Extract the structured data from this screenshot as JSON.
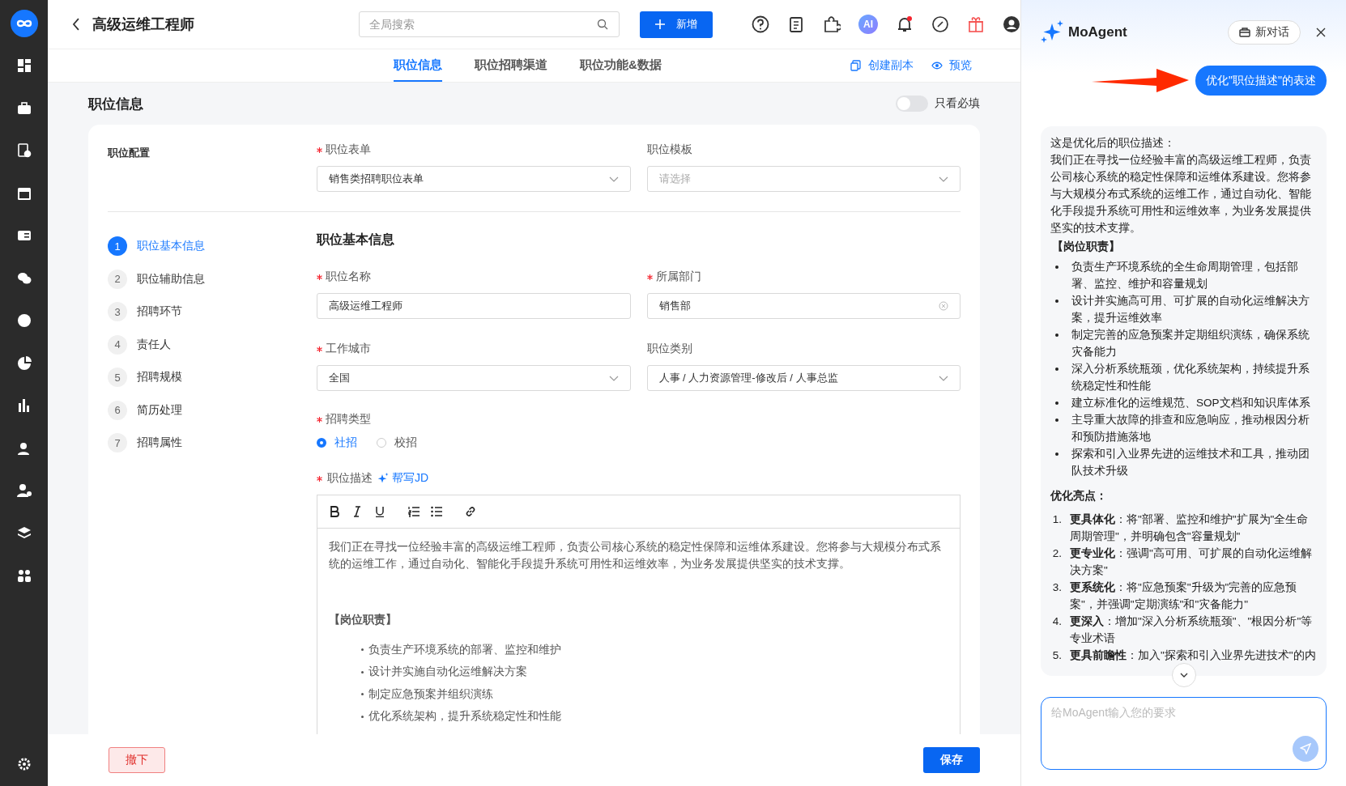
{
  "header": {
    "title": "高级运维工程师",
    "search": {
      "placeholder": "全局搜索"
    },
    "new_button": "新增",
    "ai_badge": "AI"
  },
  "tabs": [
    {
      "label": "职位信息",
      "selected": true
    },
    {
      "label": "职位招聘渠道",
      "selected": false
    },
    {
      "label": "职位功能&数据",
      "selected": false
    }
  ],
  "tab_actions": [
    "创建副本",
    "预览"
  ],
  "section": {
    "title": "职位信息",
    "toggle": {
      "label": "只看必填",
      "on": false
    }
  },
  "config": {
    "label": "职位配置",
    "fields": [
      {
        "label": "职位表单",
        "required": true,
        "value": "销售类招聘职位表单",
        "kind": "select"
      },
      {
        "label": "职位模板",
        "required": false,
        "placeholder": "请选择",
        "kind": "select"
      }
    ]
  },
  "steps": [
    {
      "number": "1",
      "label": "职位基本信息",
      "selected": true
    },
    {
      "number": "2",
      "label": "职位辅助信息",
      "selected": false
    },
    {
      "number": "3",
      "label": "招聘环节",
      "selected": false
    },
    {
      "number": "4",
      "label": "责任人",
      "selected": false
    },
    {
      "number": "5",
      "label": "招聘规模",
      "selected": false
    },
    {
      "number": "6",
      "label": "简历处理",
      "selected": false
    },
    {
      "number": "7",
      "label": "招聘属性",
      "selected": false
    }
  ],
  "basic_info": {
    "title": "职位基本信息",
    "fields": [
      {
        "label": "职位名称",
        "required": true,
        "value": "高级运维工程师",
        "kind": "input"
      },
      {
        "label": "所属部门",
        "required": true,
        "value": "销售部",
        "kind": "clearable"
      },
      {
        "label": "工作城市",
        "required": true,
        "value": "全国",
        "kind": "select"
      },
      {
        "label": "职位类别",
        "required": false,
        "value": "人事 / 人力资源管理-修改后 / 人事总监",
        "kind": "select"
      }
    ],
    "recruit_type": {
      "label": "招聘类型",
      "required": true,
      "options": [
        {
          "label": "社招",
          "selected": true
        },
        {
          "label": "校招",
          "selected": false
        }
      ]
    },
    "description": {
      "label": "职位描述",
      "required": true,
      "ai_link": "帮写JD",
      "intro": "我们正在寻找一位经验丰富的高级运维工程师，负责公司核心系统的稳定性保障和运维体系建设。您将参与大规模分布式系统的运维工作，通过自动化、智能化手段提升系统可用性和运维效率，为业务发展提供坚实的技术支撑。",
      "heading": "【岗位职责】",
      "bullets": [
        "负责生产环境系统的部署、监控和维护",
        "设计并实施自动化运维解决方案",
        "制定应急预案并组织演练",
        "优化系统架构，提升系统稳定性和性能"
      ]
    }
  },
  "footer": {
    "withdraw": "撤下",
    "save": "保存"
  },
  "agent": {
    "title": "MoAgent",
    "new_chat": "新对话",
    "user_message": "优化\"职位描述\"的表述",
    "reply": {
      "intro": "这是优化后的职位描述：",
      "paragraph": "我们正在寻找一位经验丰富的高级运维工程师，负责公司核心系统的稳定性保障和运维体系建设。您将参与大规模分布式系统的运维工作，通过自动化、智能化手段提升系统可用性和运维效率，为业务发展提供坚实的技术支撑。",
      "heading": "【岗位职责】",
      "bullets": [
        "负责生产环境系统的全生命周期管理，包括部署、监控、维护和容量规划",
        "设计并实施高可用、可扩展的自动化运维解决方案，提升运维效率",
        "制定完善的应急预案并定期组织演练，确保系统灾备能力",
        "深入分析系统瓶颈，优化系统架构，持续提升系统稳定性和性能",
        "建立标准化的运维规范、SOP文档和知识库体系",
        "主导重大故障的排查和应急响应，推动根因分析和预防措施落地",
        "探索和引入业界先进的运维技术和工具，推动团队技术升级"
      ],
      "highlights_title": "优化亮点：",
      "highlights": [
        {
          "number": "1.",
          "term": "更具体化",
          "text": "：将\"部署、监控和维护\"扩展为\"全生命周期管理\"，并明确包含\"容量规划\""
        },
        {
          "number": "2.",
          "term": "更专业化",
          "text": "：强调\"高可用、可扩展的自动化运维解决方案\""
        },
        {
          "number": "3.",
          "term": "更系统化",
          "text": "：将\"应急预案\"升级为\"完善的应急预案\"，并强调\"定期演练\"和\"灾备能力\""
        },
        {
          "number": "4.",
          "term": "更深入",
          "text": "：增加\"深入分析系统瓶颈\"、\"根因分析\"等专业术语"
        },
        {
          "number": "5.",
          "term": "更具前瞻性",
          "text": "：加入\"探索和引入业界先进技术\"的内"
        }
      ]
    },
    "input": {
      "placeholder": "给MoAgent输入您的要求"
    }
  }
}
